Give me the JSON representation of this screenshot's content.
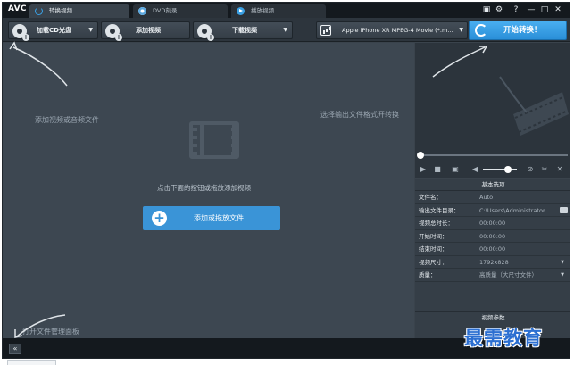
{
  "app": {
    "logo": "AVC",
    "tabs": [
      {
        "label": "转换视频",
        "icon": "convert-icon",
        "active": true
      },
      {
        "label": "DVD刻录",
        "icon": "disc-icon",
        "active": false
      },
      {
        "label": "播放视频",
        "icon": "play-icon",
        "active": false
      }
    ],
    "window_controls": {
      "minimize": "—",
      "maximize": "□",
      "close": "✕",
      "help": "?"
    }
  },
  "toolbar": {
    "add_cd": "加载CD光盘",
    "add_video": "添加视频",
    "download_video": "下载视频",
    "profile": "Apple iPhone XR MPEG-4 Movie (*.m...",
    "convert": "开始转换！"
  },
  "workspace": {
    "hint_add": "添加视频或音频文件",
    "hint_format": "选择输出文件格式开转换",
    "center_text": "点击下面的按钮或拖放添加视频",
    "add_button": "添加或拖放文件",
    "hint_panel": "打开文件管理面板"
  },
  "options": {
    "title": "基本选项",
    "rows": [
      {
        "key": "文件名：",
        "value": "Auto"
      },
      {
        "key": "输出文件目录：",
        "value": "C:\\Users\\Administrator..."
      },
      {
        "key": "视频总时长：",
        "value": "00:00:00"
      },
      {
        "key": "开始时间：",
        "value": "00:00:00"
      },
      {
        "key": "结束时间：",
        "value": "00:00:00"
      },
      {
        "key": "视频尺寸：",
        "value": "1792x828"
      },
      {
        "key": "质量：",
        "value": "高质量（大尺寸文件）"
      }
    ],
    "video_params": "视频参数"
  },
  "bottom": {
    "collapse": "«"
  },
  "watermark": "最需教育",
  "colors": {
    "accent": "#3a94d7",
    "convert": "#2a8fd8",
    "background": "#3d4751"
  }
}
